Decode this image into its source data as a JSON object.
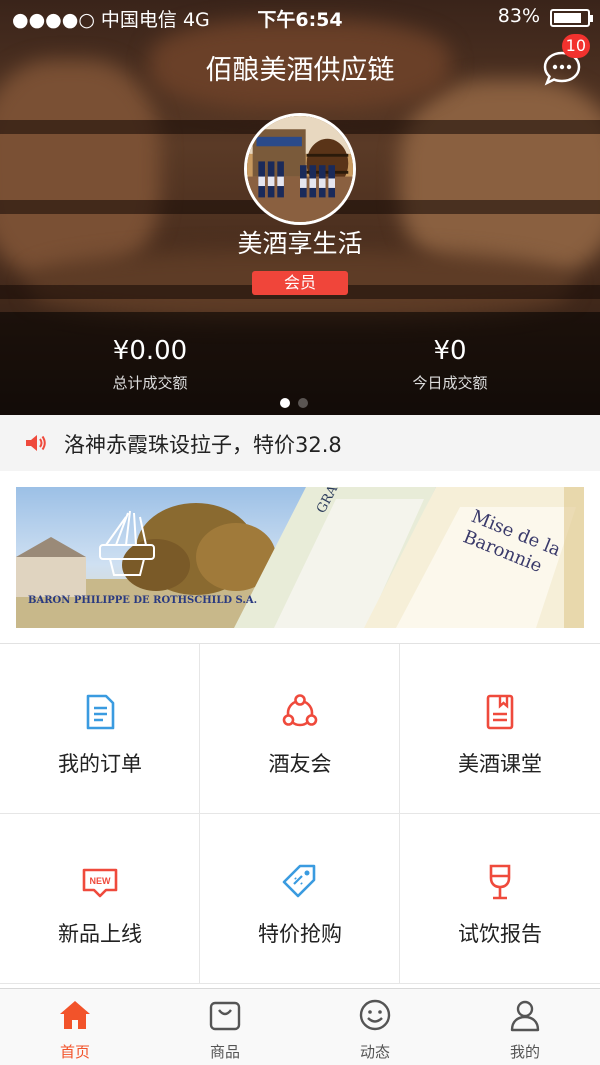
{
  "status_bar": {
    "carrier": "●●●●○ 中国电信  4G",
    "time": "下午6:54",
    "battery": "83%",
    "battery_level": 0.83
  },
  "header": {
    "title": "佰酿美酒供应链",
    "message_badge": "10"
  },
  "profile": {
    "store_name": "美酒享生活",
    "member_label": "会员"
  },
  "stats": [
    {
      "value": "¥0.00",
      "label": "总计成交额"
    },
    {
      "value": "¥0",
      "label": "今日成交额"
    }
  ],
  "carousel": {
    "page_count": 2,
    "active_index": 0
  },
  "notice": {
    "text": "洛神赤霞珠设拉子，特价32.8"
  },
  "banner": {
    "caption": "BARON PHILIPPE DE ROTHSCHILD S.A.",
    "label_main": "Mise de la Baronnie",
    "label_small": "GRAVES"
  },
  "grid": [
    {
      "label": "我的订单",
      "icon": "document-icon"
    },
    {
      "label": "酒友会",
      "icon": "group-circle-icon"
    },
    {
      "label": "美酒课堂",
      "icon": "book-icon"
    },
    {
      "label": "新品上线",
      "icon": "new-badge-icon"
    },
    {
      "label": "特价抢购",
      "icon": "price-tag-icon"
    },
    {
      "label": "试饮报告",
      "icon": "wine-glass-icon"
    }
  ],
  "tabs": [
    {
      "label": "首页",
      "icon": "home-icon",
      "active": true
    },
    {
      "label": "商品",
      "icon": "bag-icon",
      "active": false
    },
    {
      "label": "动态",
      "icon": "smiley-icon",
      "active": false
    },
    {
      "label": "我的",
      "icon": "user-icon",
      "active": false
    }
  ],
  "colors": {
    "accent": "#f2532a",
    "icon_blue": "#3a9be0",
    "icon_red": "#ef4a3c",
    "badge_red": "#f2322e"
  }
}
